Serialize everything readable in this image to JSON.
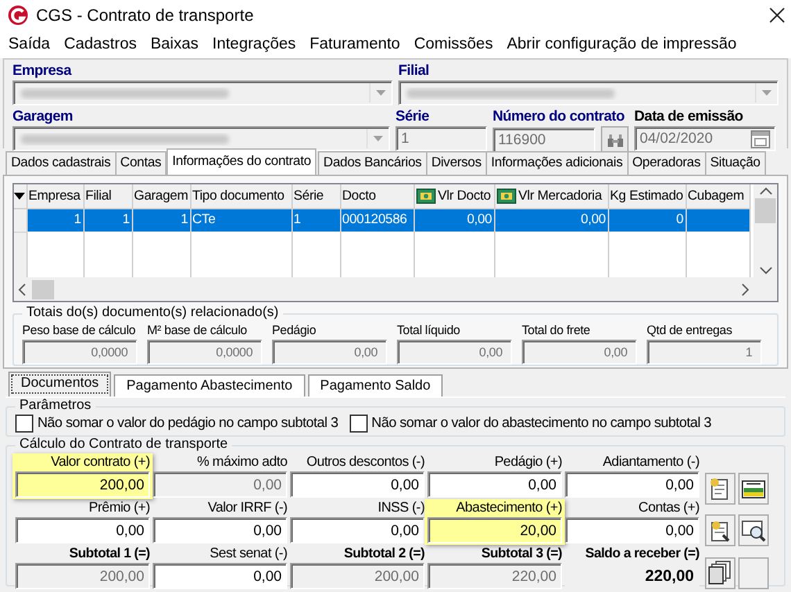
{
  "window": {
    "title": "CGS - Contrato de transporte"
  },
  "menu": [
    "Saída",
    "Cadastros",
    "Baixas",
    "Integrações",
    "Faturamento",
    "Comissões",
    "Abrir configuração de impressão"
  ],
  "header": {
    "rows": [
      [
        {
          "label": "Empresa",
          "kind": "combo"
        },
        {
          "label": "Filial",
          "kind": "combo"
        }
      ],
      [
        {
          "label": "Garagem",
          "kind": "combo"
        },
        {
          "label": "Série",
          "kind": "text",
          "value": "1"
        },
        {
          "label": "Número do contrato",
          "kind": "search",
          "value": "116900"
        },
        {
          "label": "Data de emissão",
          "kind": "date",
          "value": "04/02/2020"
        }
      ]
    ]
  },
  "tabs": [
    {
      "label": "Dados cadastrais",
      "selected": false
    },
    {
      "label": "Contas",
      "selected": false
    },
    {
      "label": "Informações do contrato",
      "selected": true
    },
    {
      "label": "Dados Bancários",
      "selected": false
    },
    {
      "label": "Diversos",
      "selected": false
    },
    {
      "label": "Informações adicionais",
      "selected": false
    },
    {
      "label": "Operadoras",
      "selected": false
    },
    {
      "label": "Situação",
      "selected": false
    }
  ],
  "grid": {
    "columns": [
      {
        "label": "Empresa",
        "kind": "number"
      },
      {
        "label": "Filial",
        "kind": "number"
      },
      {
        "label": "Garagem",
        "kind": "number"
      },
      {
        "label": "Tipo documento",
        "kind": "text"
      },
      {
        "label": "Série",
        "kind": "text"
      },
      {
        "label": "Docto",
        "kind": "text"
      },
      {
        "label": "Vlr Docto",
        "kind": "money"
      },
      {
        "label": "Vlr Mercadoria",
        "kind": "money"
      },
      {
        "label": "Kg Estimado",
        "kind": "number"
      },
      {
        "label": "Cubagem",
        "kind": "number"
      }
    ],
    "rows": [
      {
        "selected": true,
        "cells": [
          "1",
          "1",
          "1",
          "CTe",
          "1",
          "000120586",
          "0,00",
          "0,00",
          "0"
        ]
      }
    ]
  },
  "totals": {
    "title": "Totais do(s) documento(s) relacionado(s)",
    "fields": [
      {
        "label": "Peso base de cálculo",
        "value": "0,0000"
      },
      {
        "label": "M² base de cálculo",
        "value": "0,0000"
      },
      {
        "label": "Pedágio",
        "value": "0,00"
      },
      {
        "label": "Total líquido",
        "value": "0,00"
      },
      {
        "label": "Total do frete",
        "value": "0,00"
      },
      {
        "label": "Qtd de entregas",
        "value": "1"
      }
    ]
  },
  "subtabs": [
    {
      "label": "Documentos",
      "selected": true
    },
    {
      "label": "Pagamento Abastecimento",
      "selected": false
    },
    {
      "label": "Pagamento Saldo",
      "selected": false
    }
  ],
  "parameters": {
    "title": "Parâmetros",
    "options": [
      {
        "label": "Não somar o valor do pedágio no campo subtotal 3",
        "checked": false
      },
      {
        "label": "Não somar o valor do abastecimento no campo subtotal 3",
        "checked": false
      }
    ]
  },
  "calc": {
    "title": "Cálculo do Contrato de transporte",
    "rows": [
      [
        {
          "label": "Valor contrato (+)",
          "value": "200,00",
          "kind": "input",
          "highlighted": true,
          "emphasis": false
        },
        {
          "label": "% máximo adto",
          "value": "0,00",
          "kind": "readonly",
          "highlighted": false,
          "emphasis": false
        },
        {
          "label": "Outros descontos (-)",
          "value": "0,00",
          "kind": "input",
          "highlighted": false,
          "emphasis": false
        },
        {
          "label": "Pedágio (+)",
          "value": "0,00",
          "kind": "input",
          "highlighted": false,
          "emphasis": false
        },
        {
          "label": "Adiantamento (-)",
          "value": "0,00",
          "kind": "input",
          "highlighted": false,
          "emphasis": false
        }
      ],
      [
        {
          "label": "Prêmio (+)",
          "value": "0,00",
          "kind": "input",
          "highlighted": false,
          "emphasis": false
        },
        {
          "label": "Valor IRRF (-)",
          "value": "0,00",
          "kind": "input",
          "highlighted": false,
          "emphasis": false
        },
        {
          "label": "INSS (-)",
          "value": "0,00",
          "kind": "input",
          "highlighted": false,
          "emphasis": false
        },
        {
          "label": "Abastecimento (+)",
          "value": "20,00",
          "kind": "input",
          "highlighted": true,
          "emphasis": false
        },
        {
          "label": "Contas (+)",
          "value": "0,00",
          "kind": "input",
          "highlighted": false,
          "emphasis": false
        }
      ],
      [
        {
          "label": "Subtotal 1 (=)",
          "value": "200,00",
          "kind": "readonly",
          "highlighted": false,
          "emphasis": true
        },
        {
          "label": "Sest senat (-)",
          "value": "0,00",
          "kind": "input",
          "highlighted": false,
          "emphasis": false
        },
        {
          "label": "Subtotal 2 (=)",
          "value": "200,00",
          "kind": "readonly",
          "highlighted": false,
          "emphasis": true
        },
        {
          "label": "Subtotal 3 (=)",
          "value": "220,00",
          "kind": "readonly",
          "highlighted": false,
          "emphasis": true
        },
        {
          "label": "Saldo a receber (=)",
          "value": "220,00",
          "kind": "total",
          "highlighted": false,
          "emphasis": true
        }
      ]
    ]
  }
}
